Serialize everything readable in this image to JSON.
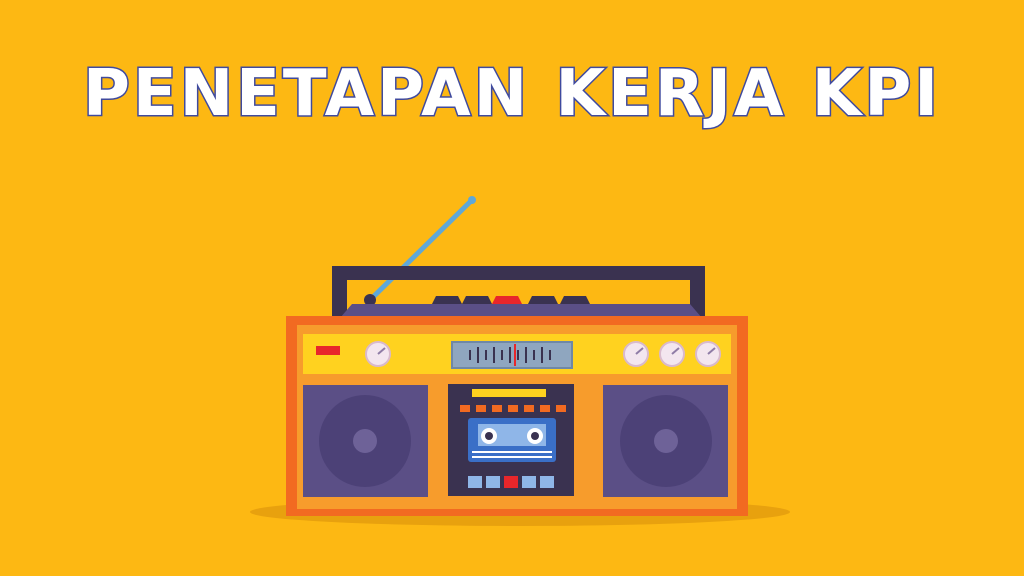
{
  "title": "PENETAPAN KERJA KPI",
  "colors": {
    "background": "#FDB813",
    "title_fill": "#FFFFFF",
    "title_stroke": "#3F4A9E",
    "body_outer": "#F26A21",
    "body_inner": "#F79C2C",
    "panel_yellow": "#FFD21F",
    "speaker": "#5B4F86",
    "speaker_cone": "#6E6298",
    "handle": "#3A3250",
    "cassette": "#3A6FC7",
    "record_button": "#E8262B",
    "antenna": "#5FA8D8"
  },
  "illustration": {
    "name": "retro-boombox",
    "parts": [
      "antenna",
      "handle",
      "top-buttons",
      "tuner-panel",
      "left-speaker",
      "cassette-deck",
      "right-speaker",
      "control-buttons",
      "shadow"
    ]
  }
}
